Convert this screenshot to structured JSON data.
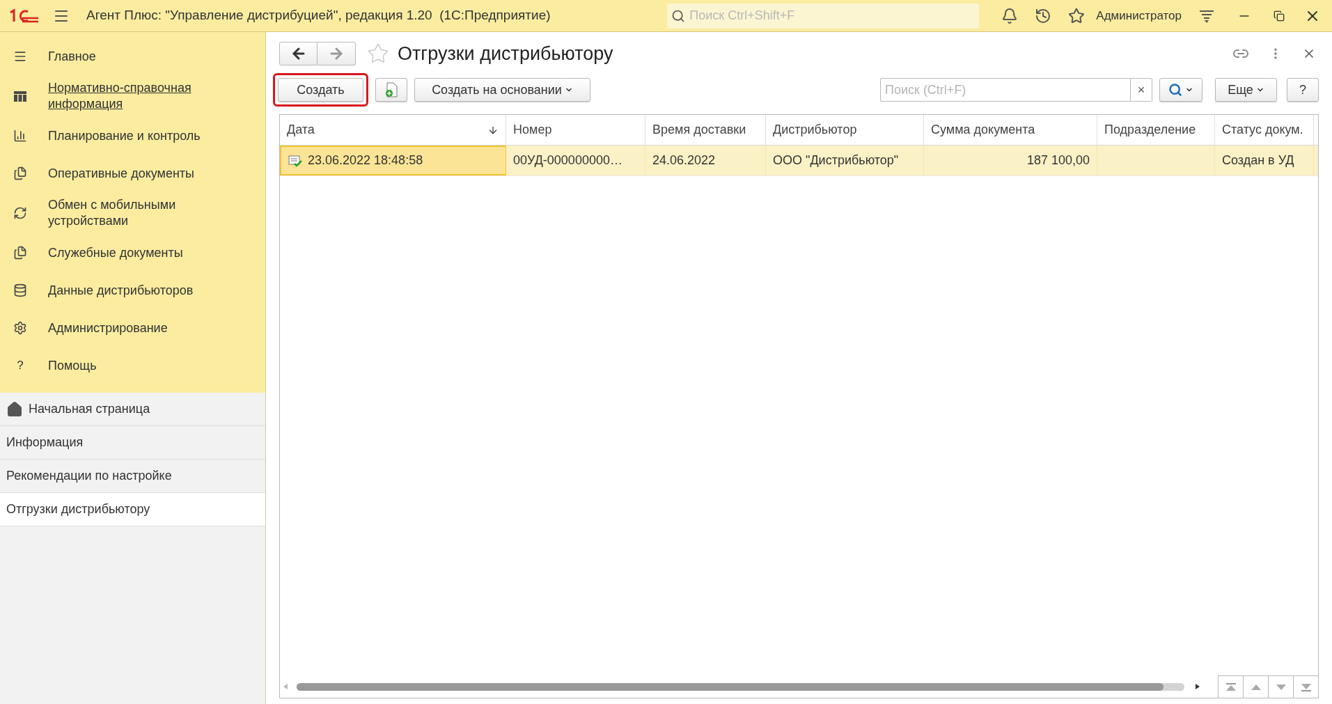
{
  "titlebar": {
    "title": "Агент Плюс: \"Управление дистрибуцией\", редакция 1.20  (1С:Предприятие)",
    "search_placeholder": "Поиск Ctrl+Shift+F",
    "user": "Администратор"
  },
  "sections": [
    {
      "label": "Главное",
      "kind": "menu",
      "link": false
    },
    {
      "label": "Нормативно-справочная информация",
      "kind": "grid",
      "link": true
    },
    {
      "label": "Планирование и контроль",
      "kind": "chart",
      "link": false
    },
    {
      "label": "Оперативные документы",
      "kind": "docs",
      "link": false
    },
    {
      "label": "Обмен с мобильными устройствами",
      "kind": "sync",
      "link": false
    },
    {
      "label": "Служебные документы",
      "kind": "docs",
      "link": false
    },
    {
      "label": "Данные дистрибьюторов",
      "kind": "db",
      "link": false
    },
    {
      "label": "Администрирование",
      "kind": "gear",
      "link": false
    },
    {
      "label": "Помощь",
      "kind": "help",
      "glyph": "?",
      "link": false
    }
  ],
  "open_windows": [
    {
      "label": "Начальная страница",
      "kind": "home",
      "selected": false
    },
    {
      "label": "Информация",
      "kind": "plain",
      "selected": false
    },
    {
      "label": "Рекомендации по настройке",
      "kind": "plain",
      "selected": false
    },
    {
      "label": "Отгрузки дистрибьютору",
      "kind": "plain",
      "selected": true
    }
  ],
  "form": {
    "title": "Отгрузки дистрибьютору",
    "favorite": false,
    "toolbar": {
      "create": "Создать",
      "create_based": "Создать на основании",
      "search_placeholder": "Поиск (Ctrl+F)",
      "clear": "×",
      "more": "Еще",
      "help": "?"
    },
    "table": {
      "columns": [
        {
          "label": "Дата",
          "sorted": true
        },
        {
          "label": "Номер",
          "sorted": false
        },
        {
          "label": "Время доставки",
          "sorted": false
        },
        {
          "label": "Дистрибьютор",
          "sorted": false
        },
        {
          "label": "Сумма документа",
          "sorted": false
        },
        {
          "label": "Подразделение",
          "sorted": false
        },
        {
          "label": "Статус докум.",
          "sorted": false
        }
      ],
      "rows": [
        {
          "selected": true,
          "cells": [
            "23.06.2022 18:48:58",
            "00УД-000000000…",
            "24.06.2022",
            "ООО \"Дистрибьютор\"",
            "187 100,00",
            "",
            "Создан в УД"
          ]
        }
      ]
    }
  }
}
